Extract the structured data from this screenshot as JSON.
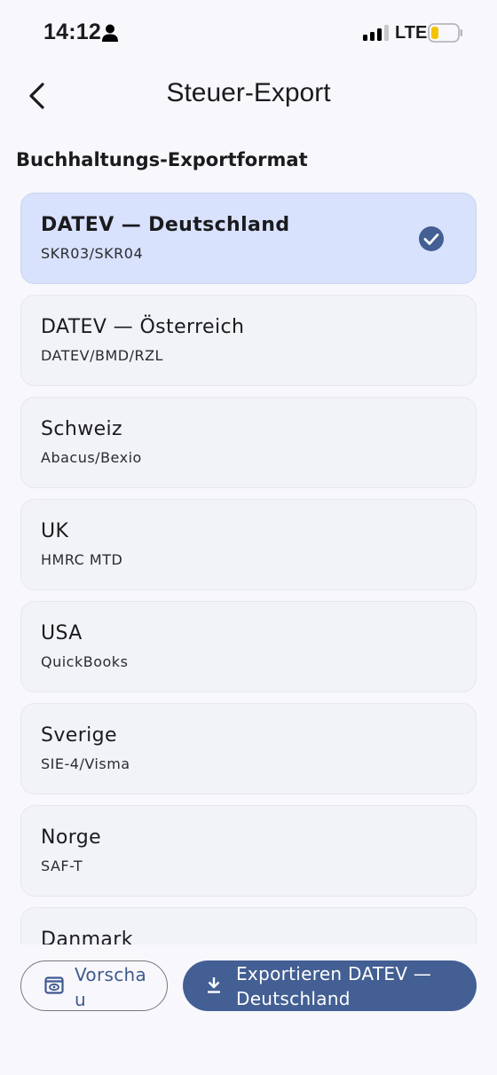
{
  "status_bar": {
    "time": "14:12",
    "network": "LTE",
    "icons": [
      "person-icon",
      "signal-icon",
      "battery-icon"
    ]
  },
  "header": {
    "title": "Steuer-Export",
    "back_icon": "chevron-left-icon"
  },
  "section": {
    "title": "Buchhaltungs-Exportformat"
  },
  "formats": [
    {
      "name": "DATEV — Deutschland",
      "sub": "SKR03/SKR04",
      "selected": true
    },
    {
      "name": "DATEV — Österreich",
      "sub": "DATEV/BMD/RZL",
      "selected": false
    },
    {
      "name": "Schweiz",
      "sub": "Abacus/Bexio",
      "selected": false
    },
    {
      "name": "UK",
      "sub": "HMRC MTD",
      "selected": false
    },
    {
      "name": "USA",
      "sub": "QuickBooks",
      "selected": false
    },
    {
      "name": "Sverige",
      "sub": "SIE-4/Visma",
      "selected": false
    },
    {
      "name": "Norge",
      "sub": "SAF-T",
      "selected": false
    },
    {
      "name": "Danmark",
      "sub": "",
      "selected": false
    }
  ],
  "actions": {
    "preview_label": "Vorschau",
    "export_label": "Exportieren DATEV — Deutschland"
  },
  "colors": {
    "accent": "#435f93",
    "selected_card": "#d9e2fc",
    "card": "#f2f3f7",
    "background": "#f8f8fc"
  }
}
